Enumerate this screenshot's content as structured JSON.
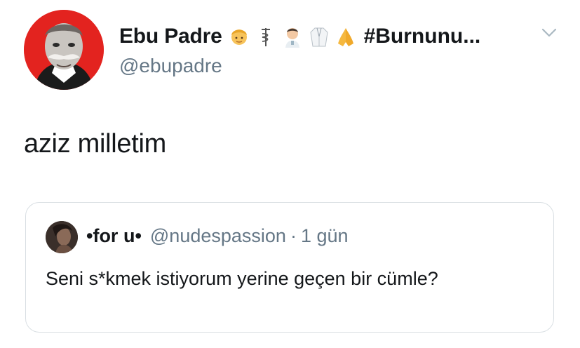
{
  "tweet": {
    "author": {
      "display_name": "Ebu Padre",
      "hashtag": "#Burnunu...",
      "handle": "@ebupadre",
      "avatar_icon": "portrait-avatar",
      "accent": "#e3231f",
      "name_emojis": [
        "person-blond-emoji",
        "medical-symbol-emoji",
        "man-health-worker-emoji",
        "lab-coat-emoji",
        "folded-hands-emoji"
      ]
    },
    "text": "aziz milletim",
    "menu_icon": "chevron-down-icon",
    "quoted": {
      "display_name": "•for u•",
      "handle": "@nudespassion",
      "separator": "·",
      "time": "1 gün",
      "text": "Seni s*kmek istiyorum yerine geçen bir cümle?"
    }
  }
}
